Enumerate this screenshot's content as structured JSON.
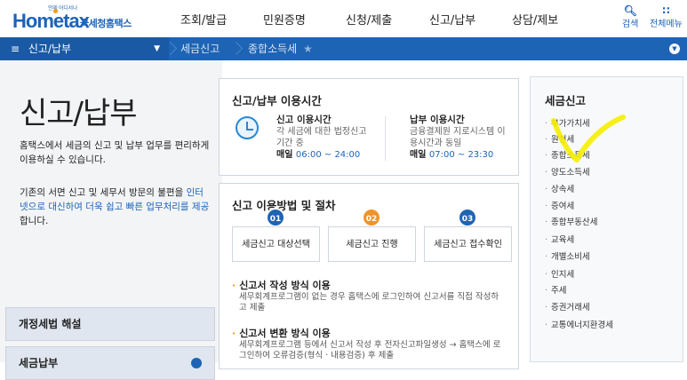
{
  "header": {
    "logo_tagline": "언제 어디서나",
    "logo_home": "Home",
    "logo_tax": "tax",
    "logo_korean": "국세청홈택스",
    "nav": [
      "조회/발급",
      "민원증명",
      "신청/제출",
      "신고/납부",
      "상담/제보"
    ],
    "search_label": "검색",
    "menu_label": "전체메뉴"
  },
  "breadcrumb": {
    "section": "신고/납부",
    "items": [
      "세금신고",
      "종합소득세"
    ]
  },
  "left": {
    "title": "신고/납부",
    "desc1": "홈택스에서 세금의 신고 및 납부 업무를 편리하게 이용하실 수 있습니다.",
    "desc2_pre": "기존의 서면 신고 및 세무서 방문의 불편을 ",
    "desc2_hl": "인터넷으로 대신하여 더욱 쉽고 빠른 업무처리를 제공",
    "desc2_post": "합니다.",
    "buttons": [
      "개정세법 해설",
      "세금납부"
    ]
  },
  "hours": {
    "title": "신고/납부 이용시간",
    "a_title": "신고 이용시간",
    "a_desc": "각 세금에 대한 법정신고 기간 중",
    "a_time_label": "매일",
    "a_time": "06:00 ~ 24:00",
    "b_title": "납부 이용시간",
    "b_desc": "금융결제원 지로시스템 이용시간과 동일",
    "b_time_label": "매일",
    "b_time": "07:00 ~ 23:30"
  },
  "procedure": {
    "title": "신고 이용방법 및 절차",
    "steps": [
      {
        "num": "01",
        "label": "세금신고 대상선택",
        "color": "#1d64b5"
      },
      {
        "num": "02",
        "label": "세금신고 진행",
        "color": "#f0932b"
      },
      {
        "num": "03",
        "label": "세금신고 접수확인",
        "color": "#1d64b5"
      }
    ],
    "m1_title": "신고서 작성 방식 이용",
    "m1_desc": "세무회계프로그램이 없는 경우 홈택스에 로그인하여 신고서를 직접 작성하고 제출",
    "m2_title": "신고서 변환 방식 이용",
    "m2_desc": "세무회계프로그램 등에서 신고서 작성 후 전자신고파일생성 → 홈택스에 로그인하여 오류검증(형식 · 내용검증) 후 제출"
  },
  "tax_menu": {
    "title": "세금신고",
    "items": [
      "부가가치세",
      "원천세",
      "종합소득세",
      "양도소득세",
      "상속세",
      "증여세",
      "종합부동산세",
      "교육세",
      "개별소비세",
      "인지세",
      "주세",
      "증권거래세",
      "교통에너지환경세"
    ]
  },
  "colors": {
    "brand": "#1d64b5",
    "accent": "#f0932b",
    "highlight": "#f5ee00"
  }
}
